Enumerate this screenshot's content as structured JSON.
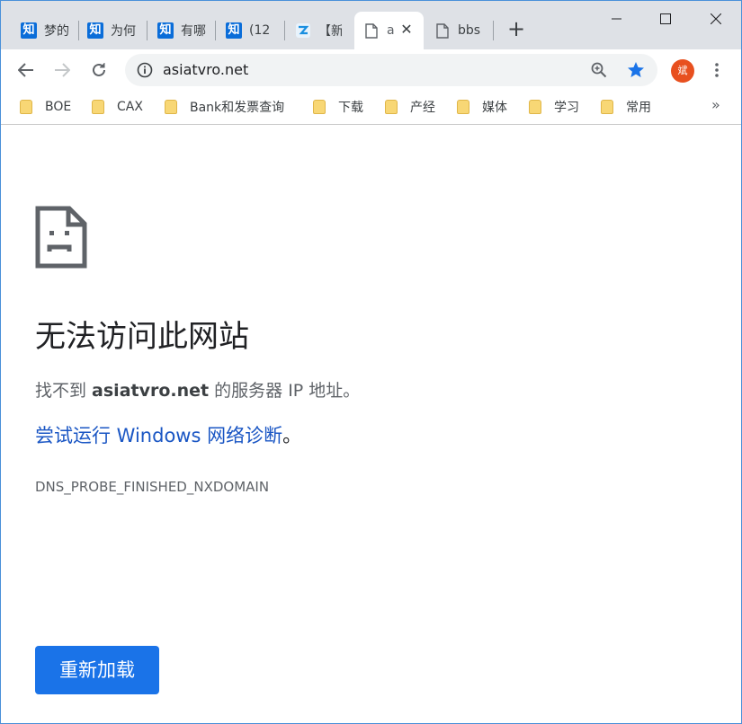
{
  "tabs": [
    {
      "title": "梦的",
      "favicon": "zhihu"
    },
    {
      "title": "为何",
      "favicon": "zhihu"
    },
    {
      "title": "有哪",
      "favicon": "zhihu"
    },
    {
      "title": "(12",
      "favicon": "zhihu"
    },
    {
      "title": "【新",
      "favicon": "iqiyi-like"
    },
    {
      "title": "a",
      "favicon": "page"
    },
    {
      "title": "bbs",
      "favicon": "page"
    }
  ],
  "zhihu_glyph": "知",
  "tab_close_glyph": "✕",
  "new_tab_glyph": "+",
  "address": {
    "url": "asiatvro.net"
  },
  "profile_initial": "斌",
  "bookmarks": [
    "BOE",
    "CAX",
    "Bank和发票查询",
    "下载",
    "产经",
    "媒体",
    "学习",
    "常用"
  ],
  "bookmarks_overflow": "»",
  "error": {
    "title": "无法访问此网站",
    "desc_prefix": "找不到 ",
    "desc_host": "asiatvro.net",
    "desc_suffix": " 的服务器 IP 地址。",
    "link": "尝试运行 Windows 网络诊断",
    "link_suffix": "。",
    "code": "DNS_PROBE_FINISHED_NXDOMAIN",
    "reload_label": "重新加载"
  },
  "colors": {
    "accent": "#1a73e8",
    "link": "#1a56c4",
    "star": "#1a73e8",
    "profile": "#e8501f"
  }
}
